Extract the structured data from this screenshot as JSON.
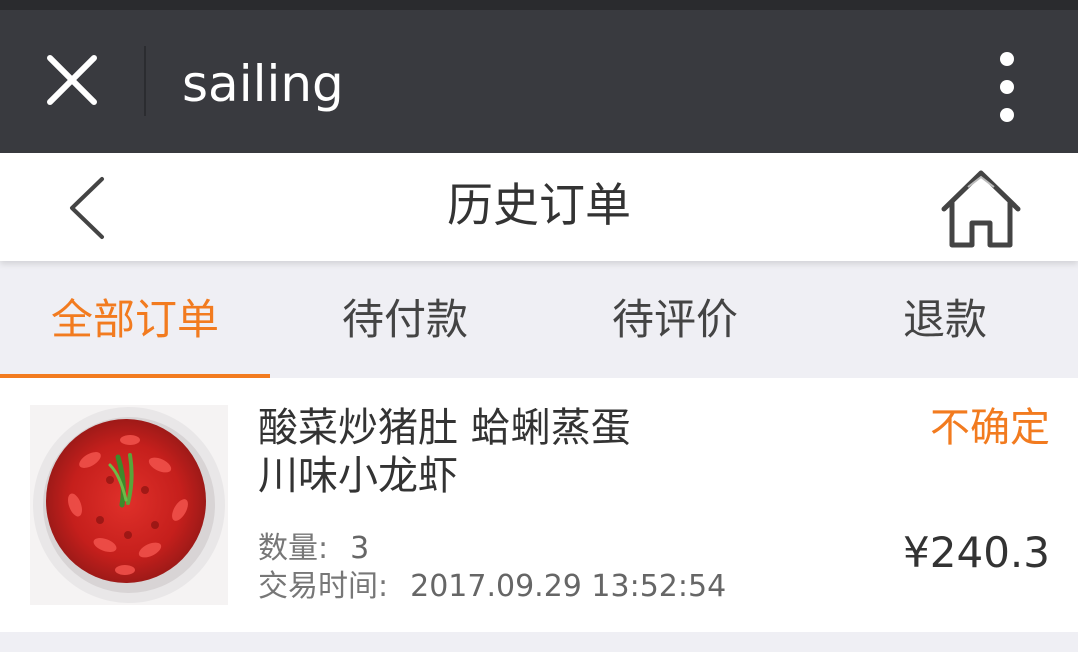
{
  "topbar": {
    "title": "sailing"
  },
  "header": {
    "title": "历史订单"
  },
  "tabs": [
    {
      "label": "全部订单",
      "active": true
    },
    {
      "label": "待付款",
      "active": false
    },
    {
      "label": "待评价",
      "active": false
    },
    {
      "label": "退款",
      "active": false
    }
  ],
  "order": {
    "items_line1": "酸菜炒猪肚 蛤蜊蒸蛋",
    "items_line2": "川味小龙虾",
    "status": "不确定",
    "quantity_label": "数量:",
    "quantity_value": "3",
    "time_label": "交易时间:",
    "time_value": "2017.09.29 13:52:54",
    "price": "¥240.3"
  },
  "colors": {
    "accent": "#f27b1f",
    "topbar": "#393a3f",
    "background": "#efeff4"
  }
}
